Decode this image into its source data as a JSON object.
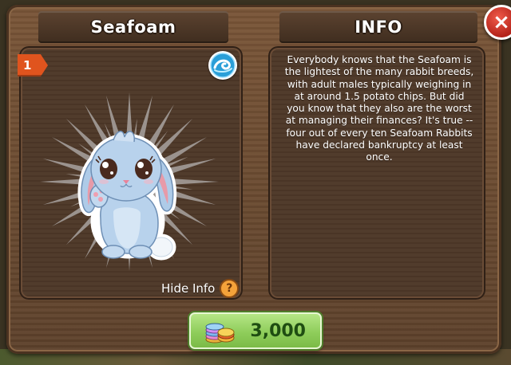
{
  "pet": {
    "name": "Seafoam",
    "level": "1",
    "element_icon": "wave-icon"
  },
  "info": {
    "title": "INFO",
    "description": "Everybody knows that the Seafoam is the lightest of the many rabbit breeds, with adult males typically weighing in at around 1.5 potato chips.  But did you know that they also are the worst at managing their finances? It's true -- four out of every ten Seafoam Rabbits have declared bankruptcy at least once."
  },
  "hide_info": {
    "label": "Hide Info",
    "icon_text": "?"
  },
  "price": {
    "value": "3,000",
    "currency_icon": "sapphire-coins-icon"
  },
  "close": {
    "icon_text": "×"
  },
  "colors": {
    "panel": "#6b4b34",
    "ribbon": "#e0541e",
    "buy_button": "#8fcd5b",
    "close": "#c3281d"
  }
}
